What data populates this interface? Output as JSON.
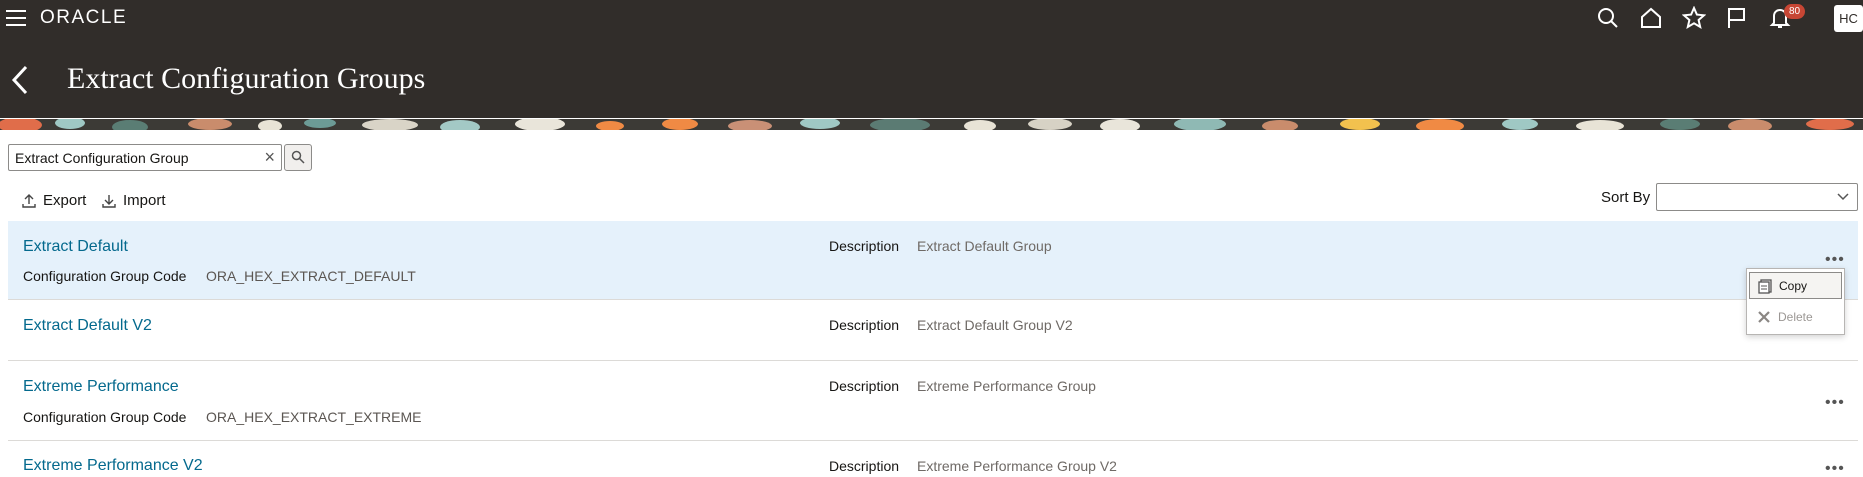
{
  "header": {
    "logo": "ORACLE",
    "notification_count": "80",
    "avatar_initials": "HC",
    "page_title": "Extract Configuration Groups"
  },
  "search": {
    "value": "Extract Configuration Group"
  },
  "toolbar": {
    "export_label": "Export",
    "import_label": "Import",
    "sort_by_label": "Sort By",
    "sort_by_value": ""
  },
  "list": {
    "description_label": "Description",
    "code_label": "Configuration Group Code",
    "items": [
      {
        "name": "Extract Default",
        "description": "Extract Default Group",
        "code": "ORA_HEX_EXTRACT_DEFAULT"
      },
      {
        "name": "Extract Default V2",
        "description": "Extract Default Group V2",
        "code": ""
      },
      {
        "name": "Extreme Performance",
        "description": "Extreme Performance Group",
        "code": "ORA_HEX_EXTRACT_EXTREME"
      },
      {
        "name": "Extreme Performance V2",
        "description": "Extreme Performance Group V2",
        "code": ""
      }
    ]
  },
  "menu": {
    "copy_label": "Copy",
    "delete_label": "Delete"
  },
  "colors": {
    "header_bg": "#312d2a",
    "link": "#04698d",
    "selected_row": "#e5f1fb",
    "badge": "#c74634"
  }
}
